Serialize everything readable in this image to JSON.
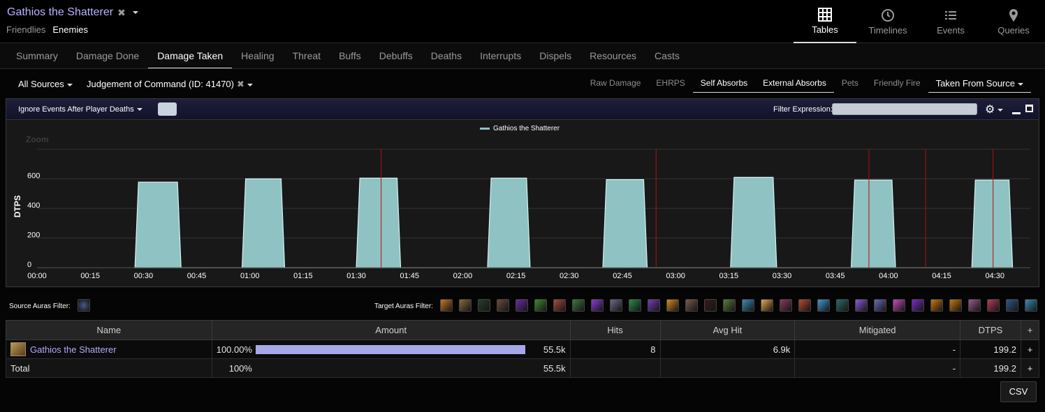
{
  "header": {
    "fight_title": "Gathios the Shatterer",
    "title_close_glyph": "✖",
    "side_options": [
      "Friendlies",
      "Enemies"
    ],
    "active_side": "Enemies"
  },
  "views": [
    {
      "label": "Tables",
      "icon": "table-icon",
      "active": true
    },
    {
      "label": "Timelines",
      "icon": "clock-icon",
      "active": false
    },
    {
      "label": "Events",
      "icon": "list-icon",
      "active": false
    },
    {
      "label": "Queries",
      "icon": "map-pin-icon",
      "active": false
    }
  ],
  "tabs": [
    "Summary",
    "Damage Done",
    "Damage Taken",
    "Healing",
    "Threat",
    "Buffs",
    "Debuffs",
    "Deaths",
    "Interrupts",
    "Dispels",
    "Resources",
    "Casts"
  ],
  "active_tab": "Damage Taken",
  "filters": {
    "source": "All Sources",
    "ability": "Judgement of Command (ID: 41470)",
    "ability_close_glyph": "✖",
    "toggles": [
      {
        "label": "Raw Damage",
        "on": false
      },
      {
        "label": "EHRPS",
        "on": false
      },
      {
        "label": "Self Absorbs",
        "on": true
      },
      {
        "label": "External Absorbs",
        "on": true
      },
      {
        "label": "Pets",
        "on": false
      },
      {
        "label": "Friendly Fire",
        "on": false
      }
    ],
    "mode_select": "Taken From Source"
  },
  "panel": {
    "ignore_label": "Ignore Events After Player Deaths",
    "filter_expression_label": "Filter Expression:",
    "filter_expression_value": "",
    "gear_glyph": "⚙"
  },
  "chart_data": {
    "type": "area",
    "legend": "Gathios the Shatterer",
    "zoom_label": "Zoom",
    "ylabel": "DTPS",
    "yticks": [
      0,
      200,
      400,
      600
    ],
    "ylim": [
      0,
      800
    ],
    "xlim_seconds": [
      0,
      280
    ],
    "xtick_labels": [
      "00:00",
      "00:15",
      "00:30",
      "00:45",
      "01:00",
      "01:15",
      "01:30",
      "01:45",
      "02:00",
      "02:15",
      "02:30",
      "02:45",
      "03:00",
      "03:15",
      "03:30",
      "03:45",
      "04:00",
      "04:15",
      "04:30"
    ],
    "series": [
      {
        "name": "Gathios the Shatterer",
        "color": "#8fc2c2",
        "points": [
          [
            27.6,
            0
          ],
          [
            28.6,
            578
          ],
          [
            39.6,
            578
          ],
          [
            40.6,
            0
          ],
          [
            57.8,
            0
          ],
          [
            58.8,
            600
          ],
          [
            68.8,
            600
          ],
          [
            69.8,
            0
          ],
          [
            90.0,
            0
          ],
          [
            91.0,
            605
          ],
          [
            101.5,
            605
          ],
          [
            102.5,
            0
          ],
          [
            127.0,
            0
          ],
          [
            128.0,
            605
          ],
          [
            138.0,
            605
          ],
          [
            139.0,
            0
          ],
          [
            159.5,
            0
          ],
          [
            160.5,
            595
          ],
          [
            171.0,
            595
          ],
          [
            172.0,
            0
          ],
          [
            195.5,
            0
          ],
          [
            196.5,
            610
          ],
          [
            207.5,
            610
          ],
          [
            208.5,
            0
          ],
          [
            229.5,
            0
          ],
          [
            230.5,
            592
          ],
          [
            241.0,
            592
          ],
          [
            242.0,
            0
          ],
          [
            263.5,
            0
          ],
          [
            264.5,
            592
          ],
          [
            274.0,
            592
          ],
          [
            275.0,
            0
          ]
        ]
      }
    ],
    "death_markers_seconds": [
      97.0,
      174.5,
      234.5,
      250.5,
      269.5
    ],
    "grid": "horizontal"
  },
  "auras": {
    "source_label": "Source Auras Filter:",
    "target_label": "Target Auras Filter:",
    "source_icons": [
      "#4a5a8a"
    ],
    "target_icons": [
      "#c8781e",
      "#8a6a3a",
      "#2a3a2a",
      "#6a4a3a",
      "#6a2aa8",
      "#3a8a2a",
      "#a84a3a",
      "#3a7a3a",
      "#8a3ad8",
      "#6a6a8a",
      "#2a8a4a",
      "#7a3ab8",
      "#d88a1a",
      "#7a5a4a",
      "#3a1a1a",
      "#5a7a3a",
      "#3a8ab8",
      "#e8a84a",
      "#8a3a5a",
      "#b84a2a",
      "#3a9ad8",
      "#2a6a6a",
      "#8a5ad8",
      "#6a6ab8",
      "#c84ab8",
      "#7a2ac8",
      "#c8780a",
      "#c8780a",
      "#9a5a8a",
      "#b83a5a",
      "#2a5a8a",
      "#3a8ab8"
    ]
  },
  "table": {
    "columns": [
      "Name",
      "Amount",
      "Hits",
      "Avg Hit",
      "Mitigated",
      "DTPS",
      "+"
    ],
    "rows": [
      {
        "name": "Gathios the Shatterer",
        "percent": "100.00%",
        "bar_fraction": 1.0,
        "amount": "55.5k",
        "hits": "8",
        "avg_hit": "6.9k",
        "mitigated": "-",
        "dtps": "199.2",
        "plus": "+"
      }
    ],
    "total": {
      "name": "Total",
      "percent": "100%",
      "amount": "55.5k",
      "hits": "",
      "avg_hit": "",
      "mitigated": "-",
      "dtps": "199.2",
      "plus": "+"
    }
  },
  "csv_label": "CSV"
}
